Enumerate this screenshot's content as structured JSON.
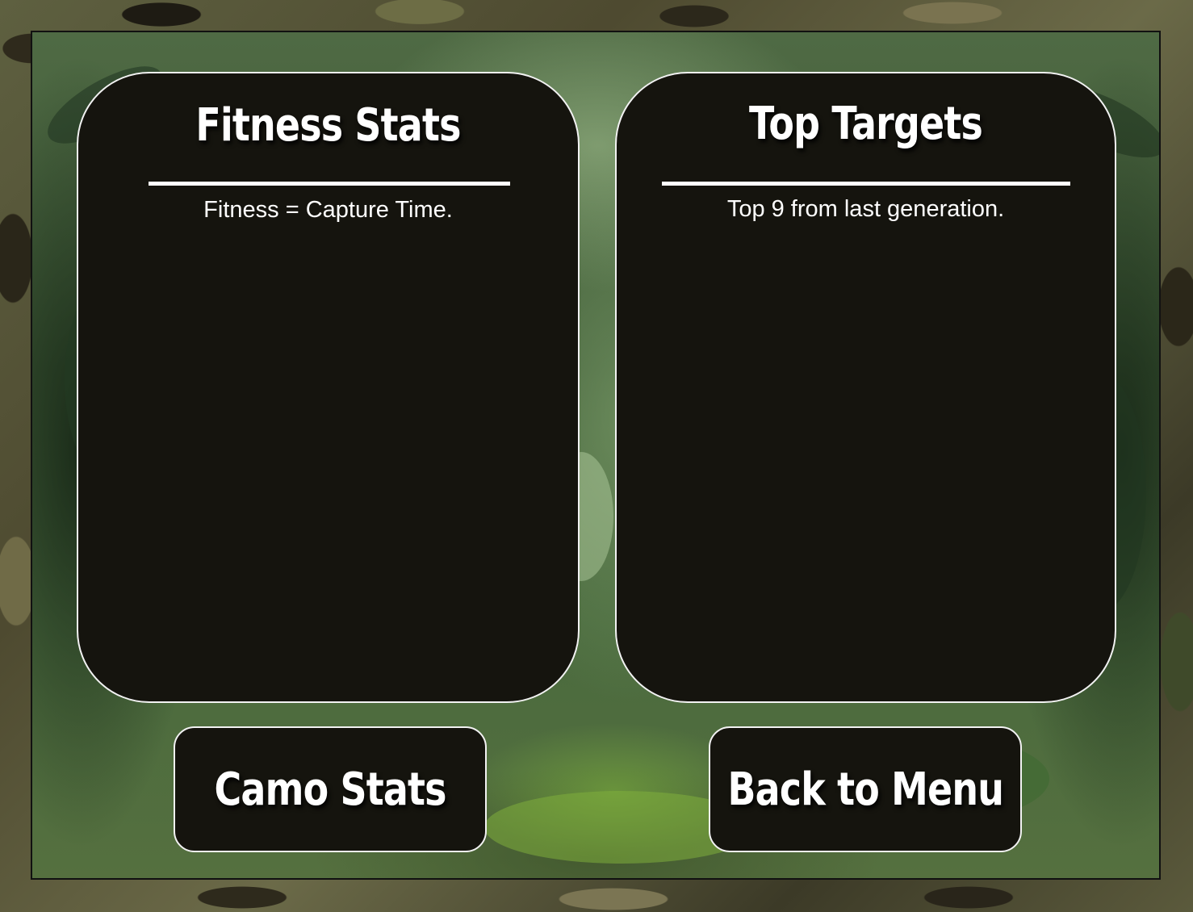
{
  "screen": "fitness-stats-screen",
  "colors": {
    "panel_bg": "#15140e",
    "panel_border": "#f2f2f2",
    "text": "#ffffff"
  },
  "fitness_panel": {
    "title": "Fitness Stats",
    "subtitle": "Fitness = Capture Time."
  },
  "targets_panel": {
    "title": "Top Targets",
    "subtitle": "Top 9 from last generation."
  },
  "buttons": {
    "camo_stats": "Camo Stats",
    "back_to_menu": "Back to Menu"
  }
}
